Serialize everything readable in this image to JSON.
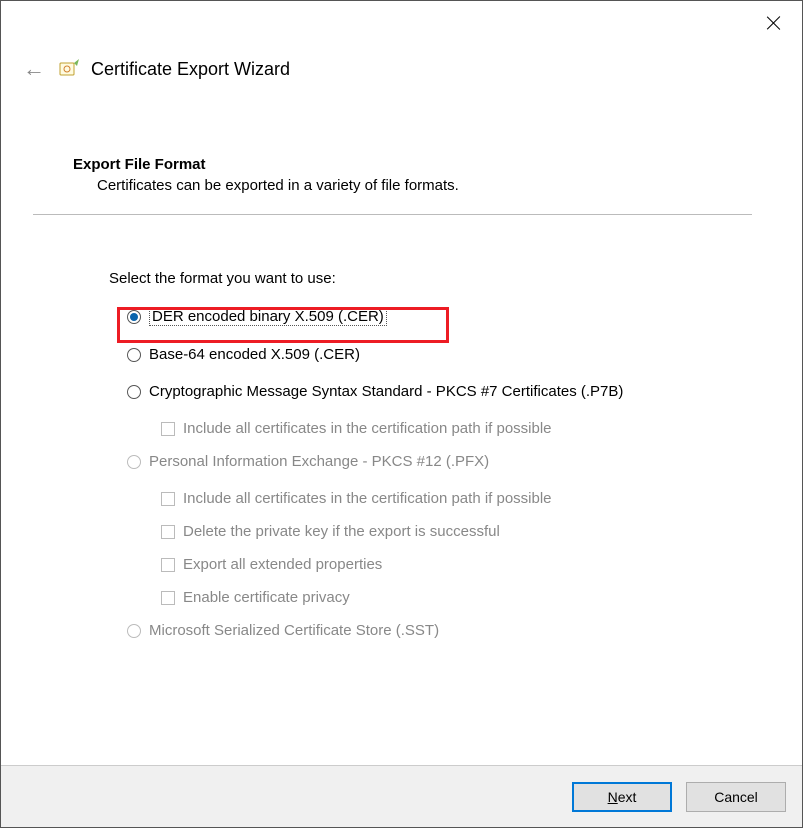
{
  "window": {
    "title": "Certificate Export Wizard"
  },
  "section": {
    "title": "Export File Format",
    "desc": "Certificates can be exported in a variety of file formats."
  },
  "prompt": "Select the format you want to use:",
  "options": {
    "der": "DER encoded binary X.509 (.CER)",
    "b64": "Base-64 encoded X.509 (.CER)",
    "p7b": "Cryptographic Message Syntax Standard - PKCS #7 Certificates (.P7B)",
    "p7b_inc": "Include all certificates in the certification path if possible",
    "pfx": "Personal Information Exchange - PKCS #12 (.PFX)",
    "pfx_inc": "Include all certificates in the certification path if possible",
    "pfx_delkey": "Delete the private key if the export is successful",
    "pfx_ext": "Export all extended properties",
    "pfx_priv": "Enable certificate privacy",
    "sst": "Microsoft Serialized Certificate Store (.SST)"
  },
  "buttons": {
    "next_u": "N",
    "next_rest": "ext",
    "cancel": "Cancel"
  }
}
